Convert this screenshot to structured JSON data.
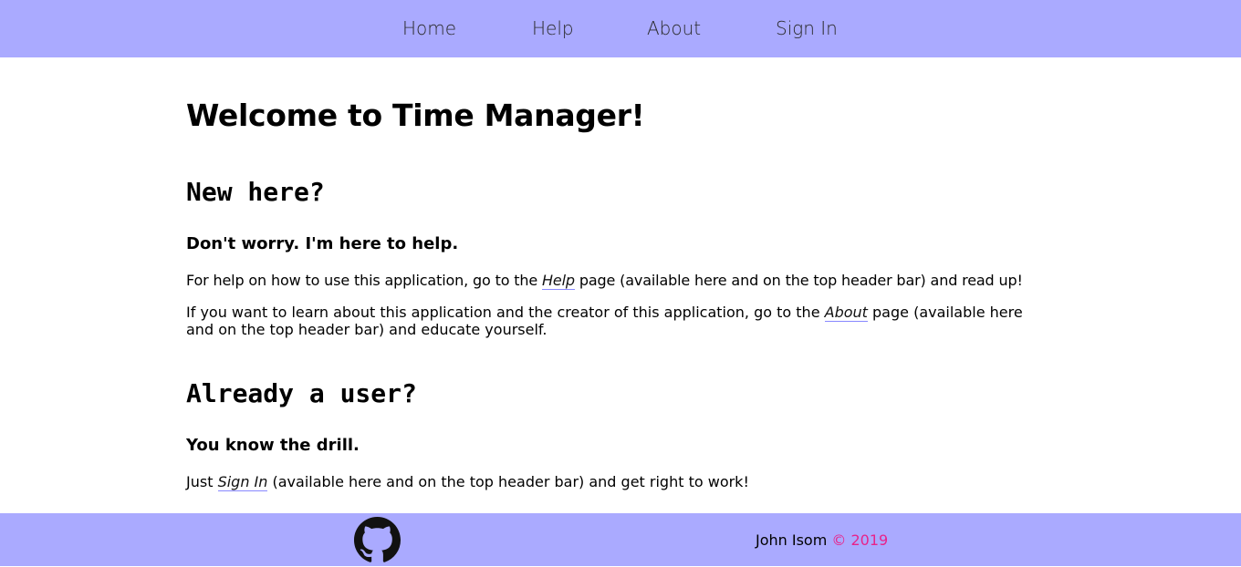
{
  "nav": {
    "home": "Home",
    "help": "Help",
    "about": "About",
    "sign_in": "Sign In"
  },
  "main": {
    "title": "Welcome to Time Manager!",
    "new_section": {
      "heading": "New here?",
      "subheading": "Don't worry. I'm here to help.",
      "help_text_before": "For help on how to use this application, go to the ",
      "help_link": "Help",
      "help_text_after": " page (available here and on the top header bar) and read up!",
      "about_text_before": "If you want to learn about this application and the creator of this application, go to the ",
      "about_link": "About",
      "about_text_after": " page (available here and on the top header bar) and educate yourself."
    },
    "user_section": {
      "heading": "Already a user?",
      "subheading": "You know the drill.",
      "signin_text_before": "Just ",
      "signin_link": "Sign In",
      "signin_text_after": " (available here and on the top header bar) and get right to work!"
    }
  },
  "footer": {
    "github_icon": "github-icon",
    "author": "John Isom",
    "copyright": "© 2019"
  },
  "colors": {
    "header_bg": "#aaaaff",
    "footer_bg": "#aaaaff",
    "link_underline": "#8888ff",
    "copyright": "#e8238a"
  }
}
